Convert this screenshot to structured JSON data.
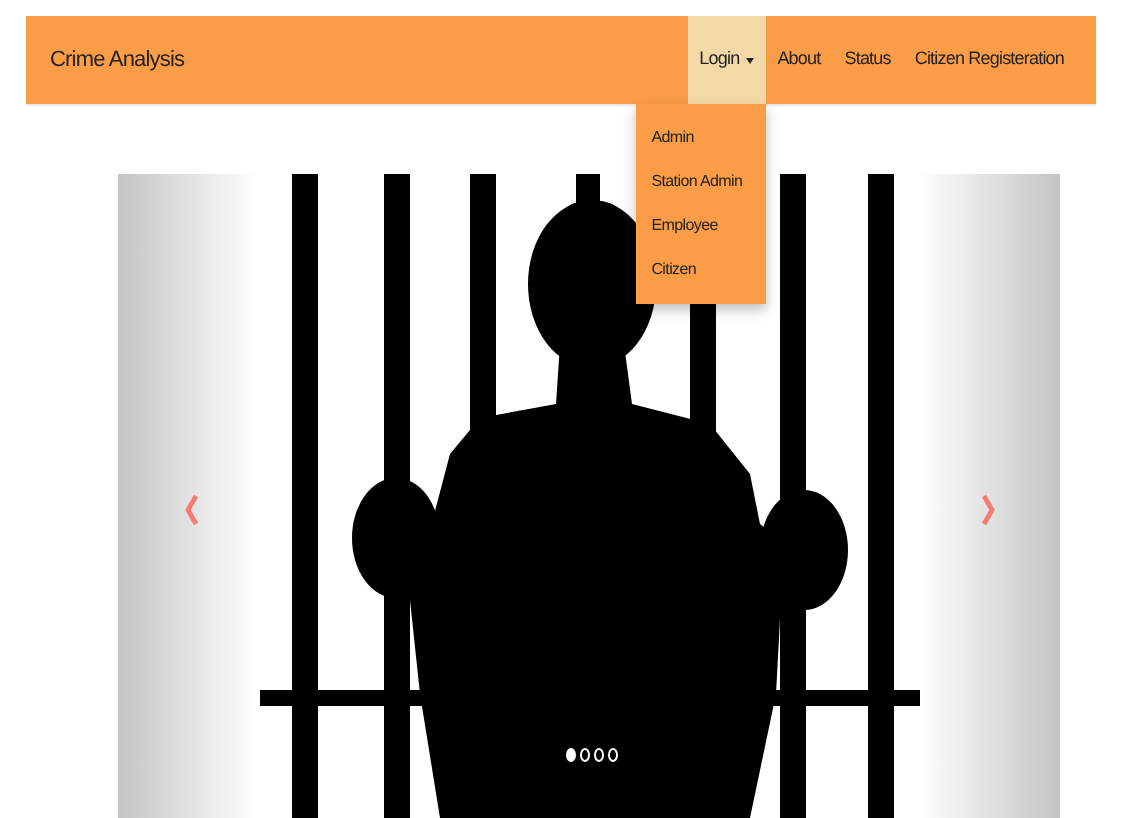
{
  "navbar": {
    "brand": "Crime Analysis",
    "items": [
      {
        "label": "Login",
        "selected": true,
        "menu": [
          "Admin",
          "Station Admin",
          "Employee",
          "Citizen"
        ]
      },
      {
        "label": "About",
        "selected": false
      },
      {
        "label": "Status",
        "selected": false
      },
      {
        "label": "Citizen Registeration",
        "selected": false
      }
    ]
  },
  "carousel": {
    "indicators": [
      {
        "selected": true
      },
      {
        "selected": false
      },
      {
        "selected": false
      },
      {
        "selected": false
      }
    ]
  }
}
